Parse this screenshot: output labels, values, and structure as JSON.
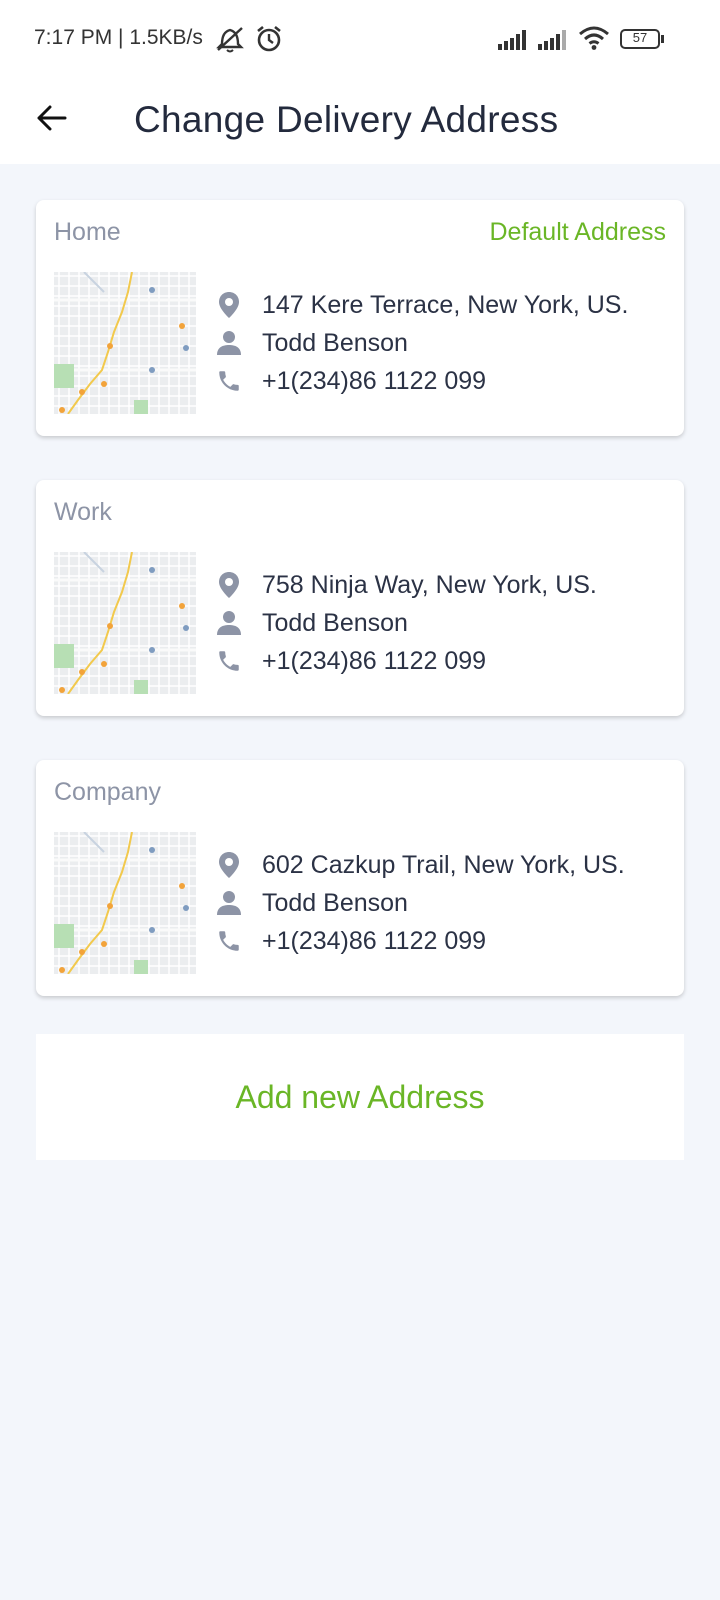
{
  "status_bar": {
    "time_text": "7:17 PM | 1.5KB/s",
    "battery": "57",
    "icons": [
      "mute-icon",
      "alarm-icon",
      "signal-icon",
      "signal-icon",
      "wifi-icon",
      "battery-icon"
    ]
  },
  "header": {
    "title": "Change Delivery Address",
    "back_icon": "back-arrow-icon"
  },
  "addresses": [
    {
      "label": "Home",
      "badge": "Default Address",
      "address": "147 Kere Terrace, New York, US.",
      "name": "Todd Benson",
      "phone": "+1(234)86 1122 099"
    },
    {
      "label": "Work",
      "badge": "",
      "address": "758 Ninja Way, New York, US.",
      "name": "Todd Benson",
      "phone": "+1(234)86 1122 099"
    },
    {
      "label": "Company",
      "badge": "",
      "address": "602 Cazkup Trail, New York, US.",
      "name": "Todd Benson",
      "phone": "+1(234)86 1122 099"
    }
  ],
  "add_button": {
    "label": "Add new Address"
  },
  "colors": {
    "accent": "#6ab626",
    "background": "#f3f6fb",
    "icon": "#8d94a6",
    "text": "#2b3245"
  }
}
